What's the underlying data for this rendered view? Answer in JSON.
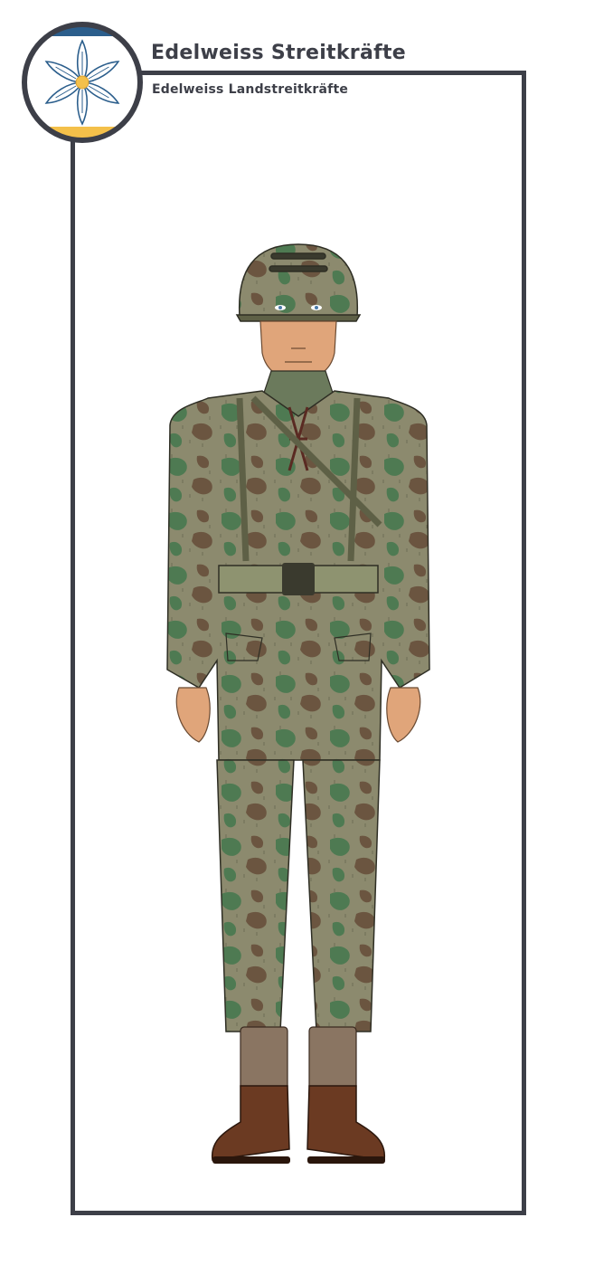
{
  "header": {
    "title": "Edelweiss Streitkräfte",
    "subtitle": "Edelweiss Landstreitkräfte"
  },
  "emblem": {
    "icon": "edelweiss-flower-icon",
    "colors": {
      "top_band": "#2b5e8c",
      "bottom_band": "#f4c04a",
      "petals": "#ffffff",
      "petal_outline": "#2b5e8c",
      "center": "#f4c04a",
      "ring": "#3d3f48"
    }
  },
  "figure": {
    "icon": "soldier-illustration",
    "colors": {
      "camo_base": "#8c8a6e",
      "camo_green": "#4e7a52",
      "camo_brown": "#6b5540",
      "skin": "#e0a57a",
      "boots": "#6b3a22",
      "gaiters": "#8a7562",
      "belt": "#8e9370"
    }
  },
  "colors": {
    "frame": "#3d3f48",
    "text": "#3d3f48",
    "background": "#ffffff"
  }
}
